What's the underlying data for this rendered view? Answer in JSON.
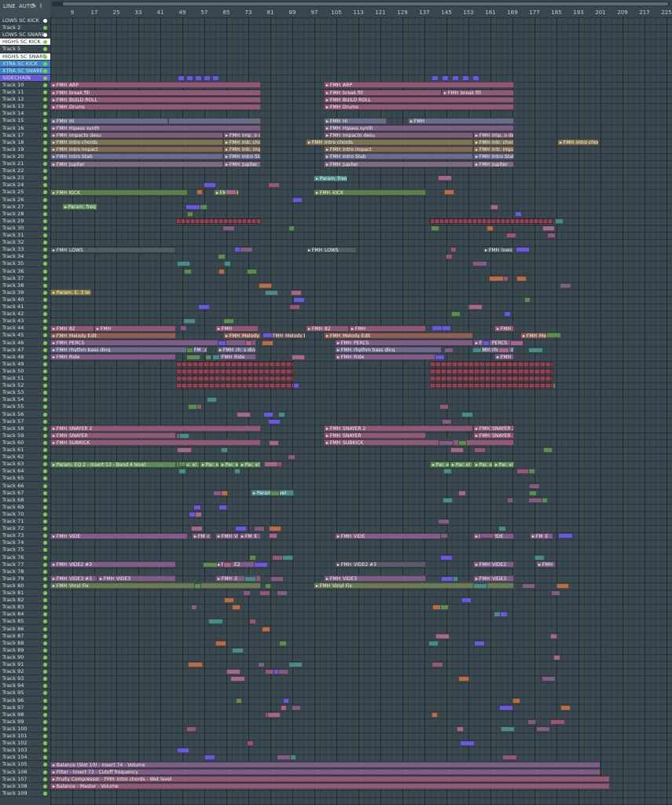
{
  "toolbar": {
    "snap_label": "LINE",
    "zoom_label": "AUTO",
    "tool_icons": [
      "pencil-icon",
      "brush-icon",
      "slice-icon"
    ]
  },
  "ruler": {
    "ticks": [
      "9",
      "17",
      "25",
      "33",
      "41",
      "49",
      "57",
      "65",
      "73",
      "81",
      "89",
      "97",
      "105",
      "113",
      "121",
      "129",
      "137",
      "145",
      "153",
      "161",
      "169",
      "177",
      "185",
      "193",
      "201",
      "209",
      "217",
      "225",
      "233"
    ]
  },
  "tracks": [
    {
      "name": "LOWS SC KICK",
      "color": "#38444c",
      "dot": "#ffffff"
    },
    {
      "name": "Track 2",
      "color": "#3b474e",
      "dot": "#7fd05a"
    },
    {
      "name": "LOWS SC SNARE",
      "color": "#38444c",
      "dot": "#ffffff"
    },
    {
      "name": "HIGHS SC KICK",
      "color": "#ffffff",
      "dot": "#7fd05a",
      "dark": true
    },
    {
      "name": "Track 5",
      "color": "#3b474e",
      "dot": "#7fd05a"
    },
    {
      "name": "HIGHS SC SNARE",
      "color": "#ffffff",
      "dot": "#7fd05a",
      "dark": true
    },
    {
      "name": "XTRA SC KICK",
      "color": "#3d87c7",
      "dot": "#7fd05a"
    },
    {
      "name": "XTRA SC SNARE",
      "color": "#3d87c7",
      "dot": "#7fd05a"
    },
    {
      "name": "SIDECHAIN",
      "color": "#6a5bd0",
      "dot": "#7fd05a"
    },
    {
      "name": "Track 10"
    },
    {
      "name": "Track 11"
    },
    {
      "name": "Track 12"
    },
    {
      "name": "Track 13"
    },
    {
      "name": "Track 14"
    },
    {
      "name": "Track 15"
    },
    {
      "name": "Track 16"
    },
    {
      "name": "Track 17"
    },
    {
      "name": "Track 18"
    },
    {
      "name": "Track 19"
    },
    {
      "name": "Track 20"
    },
    {
      "name": "Track 21"
    },
    {
      "name": "Track 22"
    },
    {
      "name": "Track 23"
    },
    {
      "name": "Track 24"
    },
    {
      "name": "Track 25"
    },
    {
      "name": "Track 26"
    },
    {
      "name": "Track 27"
    },
    {
      "name": "Track 28"
    },
    {
      "name": "Track 29"
    },
    {
      "name": "Track 30"
    },
    {
      "name": "Track 31"
    },
    {
      "name": "Track 32"
    },
    {
      "name": "Track 33"
    },
    {
      "name": "Track 34"
    },
    {
      "name": "Track 35"
    },
    {
      "name": "Track 36"
    },
    {
      "name": "Track 37"
    },
    {
      "name": "Track 38"
    },
    {
      "name": "Track 39"
    },
    {
      "name": "Track 40"
    },
    {
      "name": "Track 41"
    },
    {
      "name": "Track 42"
    },
    {
      "name": "Track 43"
    },
    {
      "name": "Track 44"
    },
    {
      "name": "Track 45"
    },
    {
      "name": "Track 46"
    },
    {
      "name": "Track 47"
    },
    {
      "name": "Track 48"
    },
    {
      "name": "Track 49"
    },
    {
      "name": "Track 50"
    },
    {
      "name": "Track 51"
    },
    {
      "name": "Track 52"
    },
    {
      "name": "Track 53"
    },
    {
      "name": "Track 54"
    },
    {
      "name": "Track 55"
    },
    {
      "name": "Track 56"
    },
    {
      "name": "Track 57"
    },
    {
      "name": "Track 58"
    },
    {
      "name": "Track 59"
    },
    {
      "name": "Track 60"
    },
    {
      "name": "Track 61"
    },
    {
      "name": "Track 62"
    },
    {
      "name": "Track 63"
    },
    {
      "name": "Track 64"
    },
    {
      "name": "Track 65"
    },
    {
      "name": "Track 66"
    },
    {
      "name": "Track 67"
    },
    {
      "name": "Track 68"
    },
    {
      "name": "Track 69"
    },
    {
      "name": "Track 70"
    },
    {
      "name": "Track 71"
    },
    {
      "name": "Track 72"
    },
    {
      "name": "Track 73"
    },
    {
      "name": "Track 74"
    },
    {
      "name": "Track 75"
    },
    {
      "name": "Track 76"
    },
    {
      "name": "Track 77"
    },
    {
      "name": "Track 78"
    },
    {
      "name": "Track 79"
    },
    {
      "name": "Track 80"
    },
    {
      "name": "Track 81"
    },
    {
      "name": "Track 82"
    },
    {
      "name": "Track 83"
    },
    {
      "name": "Track 84"
    },
    {
      "name": "Track 85"
    },
    {
      "name": "Track 86"
    },
    {
      "name": "Track 87"
    },
    {
      "name": "Track 88"
    },
    {
      "name": "Track 89"
    },
    {
      "name": "Track 90"
    },
    {
      "name": "Track 91"
    },
    {
      "name": "Track 92"
    },
    {
      "name": "Track 93"
    },
    {
      "name": "Track 94"
    },
    {
      "name": "Track 95"
    },
    {
      "name": "Track 96"
    },
    {
      "name": "Track 97"
    },
    {
      "name": "Track 98"
    },
    {
      "name": "Track 99"
    },
    {
      "name": "Track 100"
    },
    {
      "name": "Track 101"
    },
    {
      "name": "Track 102"
    },
    {
      "name": "Track 103"
    },
    {
      "name": "Track 104"
    },
    {
      "name": "Track 105"
    },
    {
      "name": "Track 106"
    },
    {
      "name": "Track 107"
    },
    {
      "name": "Track 108"
    },
    {
      "name": "Track 109"
    }
  ],
  "clips": [
    {
      "track": 10,
      "start": 0,
      "end": 268,
      "label": "FMH_ARP",
      "color": "#8d5a78"
    },
    {
      "track": 10,
      "start": 348,
      "end": 590,
      "label": "FMH_ARP",
      "color": "#8d5a78"
    },
    {
      "track": 11,
      "start": 0,
      "end": 268,
      "label": "FMH_break fill",
      "color": "#8d5a78"
    },
    {
      "track": 11,
      "start": 348,
      "end": 498,
      "label": "FMH_break fill",
      "color": "#8d5a78"
    },
    {
      "track": 11,
      "start": 498,
      "end": 590,
      "label": "FMH_break fill",
      "color": "#8d5a78"
    },
    {
      "track": 12,
      "start": 0,
      "end": 268,
      "label": "FMH_BUILD ROLL",
      "color": "#8d5a78"
    },
    {
      "track": 12,
      "start": 348,
      "end": 590,
      "label": "FMH_BUILD ROLL",
      "color": "#8d5a78"
    },
    {
      "track": 13,
      "start": 0,
      "end": 268,
      "label": "FMH_Drums",
      "color": "#8d5a78"
    },
    {
      "track": 13,
      "start": 348,
      "end": 590,
      "label": "FMH_Drums",
      "color": "#8d5a78"
    },
    {
      "track": 15,
      "start": 0,
      "end": 150,
      "label": "FMH_Hi",
      "color": "#6a6f88"
    },
    {
      "track": 15,
      "start": 150,
      "end": 268,
      "label": "",
      "color": "#6a6f88"
    },
    {
      "track": 15,
      "start": 348,
      "end": 428,
      "label": "FMH_Hi",
      "color": "#6a6f88"
    },
    {
      "track": 15,
      "start": 455,
      "end": 590,
      "label": "FMH_",
      "color": "#6a6f88"
    },
    {
      "track": 16,
      "start": 0,
      "end": 268,
      "label": "FMH_Hipass synth",
      "color": "#7d5f85"
    },
    {
      "track": 16,
      "start": 348,
      "end": 590,
      "label": "FMH_Hipass synth",
      "color": "#7d5f85"
    },
    {
      "track": 17,
      "start": 0,
      "end": 220,
      "label": "FMH_Impacto desu",
      "color": "#7a6078"
    },
    {
      "track": 17,
      "start": 220,
      "end": 268,
      "label": "FMH_Imp. o desu",
      "color": "#7a6078"
    },
    {
      "track": 17,
      "start": 348,
      "end": 538,
      "label": "FMH_Impacto desu",
      "color": "#7a6078"
    },
    {
      "track": 17,
      "start": 538,
      "end": 590,
      "label": "FMH_Imp. o desu",
      "color": "#7a6078"
    },
    {
      "track": 18,
      "start": 0,
      "end": 220,
      "label": "FMH_Intro chords",
      "color": "#7f7355"
    },
    {
      "track": 18,
      "start": 220,
      "end": 268,
      "label": "FMH_Intr. chords",
      "color": "#7f7355"
    },
    {
      "track": 18,
      "start": 325,
      "end": 538,
      "label": "FMH_Intro chords",
      "color": "#7f7355"
    },
    {
      "track": 18,
      "start": 538,
      "end": 590,
      "label": "FMH_Intr. chords",
      "color": "#7f7355"
    },
    {
      "track": 18,
      "start": 645,
      "end": 698,
      "label": "FMH_Intro chords",
      "color": "#7f7355"
    },
    {
      "track": 19,
      "start": 0,
      "end": 220,
      "label": "FMH_Intro impact",
      "color": "#7f6a5a"
    },
    {
      "track": 19,
      "start": 220,
      "end": 268,
      "label": "FMH_Intr. impact",
      "color": "#7f6a5a"
    },
    {
      "track": 19,
      "start": 348,
      "end": 538,
      "label": "FMH_Intro impact",
      "color": "#7f6a5a"
    },
    {
      "track": 19,
      "start": 538,
      "end": 590,
      "label": "FMH_Intr. impact",
      "color": "#7f6a5a"
    },
    {
      "track": 20,
      "start": 0,
      "end": 220,
      "label": "FMH_Intro Stab",
      "color": "#6e6a8c"
    },
    {
      "track": 20,
      "start": 220,
      "end": 268,
      "label": "FMH_Intro Stab",
      "color": "#6e6a8c"
    },
    {
      "track": 20,
      "start": 348,
      "end": 538,
      "label": "FMH_Intro Stab",
      "color": "#6e6a8c"
    },
    {
      "track": 20,
      "start": 538,
      "end": 590,
      "label": "FMH_Intro Stab",
      "color": "#6e6a8c"
    },
    {
      "track": 21,
      "start": 0,
      "end": 220,
      "label": "FMH_Jupiter",
      "color": "#7d6b82"
    },
    {
      "track": 21,
      "start": 220,
      "end": 268,
      "label": "FMH_Jupiter",
      "color": "#7d6b82"
    },
    {
      "track": 21,
      "start": 348,
      "end": 538,
      "label": "FMH_Jupiter",
      "color": "#7d6b82"
    },
    {
      "track": 21,
      "start": 538,
      "end": 590,
      "label": "FMH_Jupiter",
      "color": "#7d6b82"
    },
    {
      "track": 23,
      "start": 335,
      "end": 378,
      "label": "Param. freq",
      "color": "#4d8a86"
    },
    {
      "track": 25,
      "start": 0,
      "end": 175,
      "label": "FMH_KICK",
      "color": "#5e7d52"
    },
    {
      "track": 25,
      "start": 208,
      "end": 240,
      "label": "FMH_KICK",
      "color": "#5e7d52"
    },
    {
      "track": 25,
      "start": 335,
      "end": 478,
      "label": "FMH_KICK",
      "color": "#5e7d52"
    },
    {
      "track": 27,
      "start": 15,
      "end": 60,
      "label": "Param. freq",
      "color": "#5f8a5a"
    },
    {
      "track": 33,
      "start": 0,
      "end": 160,
      "label": "FMH_LOWS",
      "color": "#4e5d64"
    },
    {
      "track": 33,
      "start": 325,
      "end": 390,
      "label": "FMH_LOWS",
      "color": "#4e5d64"
    },
    {
      "track": 33,
      "start": 550,
      "end": 590,
      "label": "FMH_lows",
      "color": "#4e5d64"
    },
    {
      "track": 39,
      "start": 0,
      "end": 52,
      "label": "Param. E. 3 level",
      "color": "#8a7a4a"
    },
    {
      "track": 44,
      "start": 0,
      "end": 56,
      "label": "FMH_82",
      "color": "#8d5a78"
    },
    {
      "track": 44,
      "start": 56,
      "end": 160,
      "label": "FMH",
      "color": "#8d5a78"
    },
    {
      "track": 44,
      "start": 210,
      "end": 265,
      "label": "FMH",
      "color": "#8d5a78"
    },
    {
      "track": 44,
      "start": 325,
      "end": 380,
      "label": "FMH_82",
      "color": "#8d5a78"
    },
    {
      "track": 44,
      "start": 380,
      "end": 478,
      "label": "FMH",
      "color": "#8d5a78"
    },
    {
      "track": 44,
      "start": 565,
      "end": 590,
      "label": "FMH",
      "color": "#8d5a78"
    },
    {
      "track": 45,
      "start": 0,
      "end": 160,
      "label": "FMH_Melody Edit",
      "color": "#8a6058"
    },
    {
      "track": 45,
      "start": 220,
      "end": 268,
      "label": "FMH_Melody Edit",
      "color": "#8a6058"
    },
    {
      "track": 45,
      "start": 275,
      "end": 325,
      "label": "FMH_Melody Edit",
      "color": "#6a5a56"
    },
    {
      "track": 45,
      "start": 348,
      "end": 538,
      "label": "FMH_Melody Edit",
      "color": "#8a6058"
    },
    {
      "track": 45,
      "start": 598,
      "end": 643,
      "label": "FMH_Melody Edit",
      "color": "#8a6058"
    },
    {
      "track": 46,
      "start": 0,
      "end": 262,
      "label": "FMH_PERCS",
      "color": "#7d5f85"
    },
    {
      "track": 46,
      "start": 362,
      "end": 538,
      "label": "FMH_PERCS",
      "color": "#7d5f85"
    },
    {
      "track": 46,
      "start": 538,
      "end": 590,
      "label": "FMH_PERCS",
      "color": "#7d5f85"
    },
    {
      "track": 47,
      "start": 0,
      "end": 175,
      "label": "FMH_rhythm bass ding",
      "color": "#6e6a8c"
    },
    {
      "track": 47,
      "start": 175,
      "end": 200,
      "label": "FM_.c",
      "color": "#6e6a8c"
    },
    {
      "track": 47,
      "start": 212,
      "end": 262,
      "label": "FMH_rh. s ding",
      "color": "#6e6a8c"
    },
    {
      "track": 47,
      "start": 362,
      "end": 498,
      "label": "FMH_rhythm bass ding",
      "color": "#6e6a8c"
    },
    {
      "track": 47,
      "start": 538,
      "end": 590,
      "label": "FMH_rhyt. ss ding",
      "color": "#6e6a8c"
    },
    {
      "track": 48,
      "start": 0,
      "end": 160,
      "label": "FMH_Ride",
      "color": "#7d5f85"
    },
    {
      "track": 48,
      "start": 210,
      "end": 262,
      "label": "FMH_Ride",
      "color": "#7d5f85"
    },
    {
      "track": 48,
      "start": 362,
      "end": 498,
      "label": "FMH_Ride",
      "color": "#7d5f85"
    },
    {
      "track": 48,
      "start": 565,
      "end": 590,
      "label": "FMH_Ride",
      "color": "#7d5f85"
    },
    {
      "track": 58,
      "start": 0,
      "end": 268,
      "label": "FMH_SNAYER 2",
      "color": "#8d5a78"
    },
    {
      "track": 58,
      "start": 348,
      "end": 538,
      "label": "FMH_SNAYER 2",
      "color": "#8d5a78"
    },
    {
      "track": 58,
      "start": 538,
      "end": 590,
      "label": "FMH_SNAYER 2",
      "color": "#8d5a78"
    },
    {
      "track": 59,
      "start": 0,
      "end": 160,
      "label": "FMH_SNAYER",
      "color": "#8d5a78"
    },
    {
      "track": 59,
      "start": 348,
      "end": 478,
      "label": "FMH_SNAYER",
      "color": "#8d5a78"
    },
    {
      "track": 59,
      "start": 538,
      "end": 590,
      "label": "FMH_SNAYER",
      "color": "#8d5a78"
    },
    {
      "track": 60,
      "start": 0,
      "end": 268,
      "label": "FMH_SUBKICK",
      "color": "#8d5a78"
    },
    {
      "track": 60,
      "start": 348,
      "end": 590,
      "label": "FMH_SUBKICK",
      "color": "#8d5a78"
    },
    {
      "track": 63,
      "start": 0,
      "end": 160,
      "label": "Param. EQ 2 - Insert 53 - Band 4 level",
      "color": "#5f8a5a"
    },
    {
      "track": 63,
      "start": 160,
      "end": 190,
      "label": "Par. el",
      "color": "#5f8a5a"
    },
    {
      "track": 63,
      "start": 190,
      "end": 215,
      "label": "Par. el",
      "color": "#5f8a5a"
    },
    {
      "track": 63,
      "start": 215,
      "end": 240,
      "label": "Par. el",
      "color": "#5f8a5a"
    },
    {
      "track": 63,
      "start": 240,
      "end": 268,
      "label": "Par. el",
      "color": "#5f8a5a"
    },
    {
      "track": 63,
      "start": 483,
      "end": 508,
      "label": "Par. el",
      "color": "#5f8a5a"
    },
    {
      "track": 63,
      "start": 508,
      "end": 538,
      "label": "Par. el",
      "color": "#5f8a5a"
    },
    {
      "track": 63,
      "start": 538,
      "end": 563,
      "label": "Par. el",
      "color": "#5f8a5a"
    },
    {
      "track": 63,
      "start": 563,
      "end": 590,
      "label": "Par. el",
      "color": "#5f8a5a"
    },
    {
      "track": 67,
      "start": 255,
      "end": 310,
      "label": "Param. level",
      "color": "#4d8a86"
    },
    {
      "track": 73,
      "start": 0,
      "end": 175,
      "label": "FMH_VIDE",
      "color": "#7d5f85"
    },
    {
      "track": 73,
      "start": 180,
      "end": 205,
      "label": "FM_c",
      "color": "#7d5f85"
    },
    {
      "track": 73,
      "start": 210,
      "end": 240,
      "label": "FMH_VIDE",
      "color": "#7d5f85"
    },
    {
      "track": 73,
      "start": 240,
      "end": 268,
      "label": "FM_E",
      "color": "#7d5f85"
    },
    {
      "track": 73,
      "start": 362,
      "end": 498,
      "label": "FMH_VIDE",
      "color": "#7d5f85"
    },
    {
      "track": 73,
      "start": 538,
      "end": 590,
      "label": "FMH_VIDE",
      "color": "#7d5f85"
    },
    {
      "track": 73,
      "start": 610,
      "end": 640,
      "label": "FM_E",
      "color": "#7d5f85"
    },
    {
      "track": 77,
      "start": 0,
      "end": 160,
      "label": "FMH_VIDE2 #3",
      "color": "#7d5f85"
    },
    {
      "track": 77,
      "start": 210,
      "end": 268,
      "label": "FMH_E2",
      "color": "#7d5f85"
    },
    {
      "track": 77,
      "start": 362,
      "end": 478,
      "label": "FMH_VIDE2 #3",
      "color": "#5e5968"
    },
    {
      "track": 77,
      "start": 538,
      "end": 590,
      "label": "FMH_VIDE2",
      "color": "#7d5f85"
    },
    {
      "track": 77,
      "start": 618,
      "end": 643,
      "label": "FMH_VIDE2",
      "color": "#7d5f85"
    },
    {
      "track": 79,
      "start": 0,
      "end": 60,
      "label": "FMH_VIDE3 #3",
      "color": "#7d5f85"
    },
    {
      "track": 79,
      "start": 60,
      "end": 160,
      "label": "FMH_VIDE3",
      "color": "#7d5f85"
    },
    {
      "track": 79,
      "start": 210,
      "end": 268,
      "label": "FMH_3",
      "color": "#7d5f85"
    },
    {
      "track": 79,
      "start": 348,
      "end": 478,
      "label": "FMH_VIDE3",
      "color": "#7d5f85"
    },
    {
      "track": 79,
      "start": 538,
      "end": 590,
      "label": "FMH_VIDE3",
      "color": "#7d5f85"
    },
    {
      "track": 80,
      "start": 0,
      "end": 268,
      "label": "FMH_Vinyl Fix",
      "color": "#6a7a58"
    },
    {
      "track": 80,
      "start": 335,
      "end": 590,
      "label": "FMH_Vinyl Fix",
      "color": "#6a7a58"
    },
    {
      "track": 105,
      "start": 0,
      "end": 700,
      "label": "Balance (Slot 10) - Insert 74 - Volume",
      "color": "#7d5f85"
    },
    {
      "track": 106,
      "start": 0,
      "end": 700,
      "label": "Filter - Insert 73 - Cutoff frequency",
      "color": "#7d5f85"
    },
    {
      "track": 107,
      "start": 0,
      "end": 712,
      "label": "Fruity Compressor - FMH_Intro chords - Wet level",
      "color": "#8d5a78"
    },
    {
      "track": 108,
      "start": 0,
      "end": 712,
      "label": "Balance - Master - Volume",
      "color": "#8d5a78"
    }
  ],
  "colors": {
    "grid_bg": "#3a4850",
    "track_panel": "#3b474e",
    "accent_pattern_purple": "#6a5bd0",
    "clip_mauve": "#8d5a78",
    "clip_green": "#5f8a5a",
    "clip_teal": "#4d8a86"
  }
}
